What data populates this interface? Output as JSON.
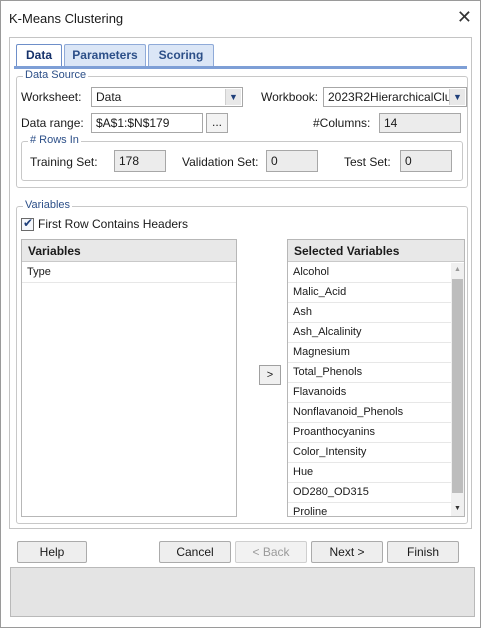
{
  "window": {
    "title": "K-Means Clustering",
    "close_glyph": "✕"
  },
  "tabs": [
    {
      "label": "Data",
      "active": true
    },
    {
      "label": "Parameters",
      "active": false
    },
    {
      "label": "Scoring",
      "active": false
    }
  ],
  "data_source": {
    "legend": "Data Source",
    "worksheet_label": "Worksheet:",
    "worksheet_value": "Data",
    "workbook_label": "Workbook:",
    "workbook_value": "2023R2HierarchicalClu:",
    "data_range_label": "Data range:",
    "data_range_value": "$A$1:$N$179",
    "ellipsis": "...",
    "columns_label": "#Columns:",
    "columns_value": "14",
    "rows_in": {
      "legend": "# Rows In",
      "training_label": "Training Set:",
      "training_value": "178",
      "validation_label": "Validation Set:",
      "validation_value": "0",
      "test_label": "Test Set:",
      "test_value": "0"
    }
  },
  "variables": {
    "legend": "Variables",
    "first_row_checkbox_label": "First Row Contains Headers",
    "first_row_checked": true,
    "left_header": "Variables",
    "left_items": [
      "Type"
    ],
    "right_header": "Selected Variables",
    "right_items": [
      "Alcohol",
      "Malic_Acid",
      "Ash",
      "Ash_Alcalinity",
      "Magnesium",
      "Total_Phenols",
      "Flavanoids",
      "Nonflavanoid_Phenols",
      "Proanthocyanins",
      "Color_Intensity",
      "Hue",
      "OD280_OD315",
      "Proline"
    ],
    "move_right": ">"
  },
  "footer": {
    "help": "Help",
    "cancel": "Cancel",
    "back": "< Back",
    "next": "Next >",
    "finish": "Finish"
  },
  "icons": {
    "dropdown": "chevron-down-icon",
    "checkbox_mark": "✔",
    "scroll_up": "▲",
    "scroll_down": "▼"
  }
}
